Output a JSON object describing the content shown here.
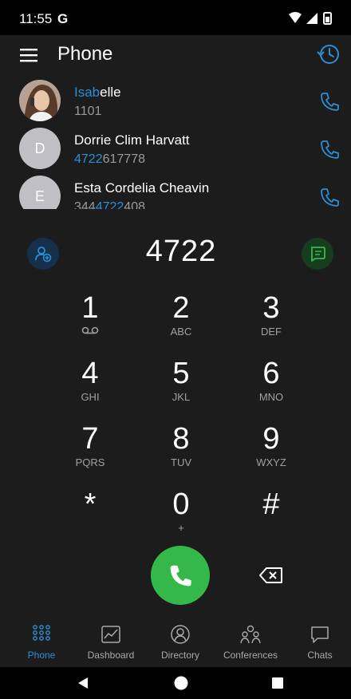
{
  "status": {
    "time": "11:55",
    "g_label": "G"
  },
  "header": {
    "title": "Phone",
    "menu_icon": "hamburger-menu-icon",
    "history_icon": "history-icon"
  },
  "contacts": [
    {
      "name_match": "Isab",
      "name_rest": "elle",
      "number_pre": "",
      "number_match": "",
      "number_post": "1101",
      "avatar_letter": "",
      "avatar_type": "photo"
    },
    {
      "name_match": "",
      "name_rest": "Dorrie Clim Harvatt",
      "number_pre": "",
      "number_match": "4722",
      "number_post": "617778",
      "avatar_letter": "D",
      "avatar_type": "letter"
    },
    {
      "name_match": "",
      "name_rest": "Esta Cordelia Cheavin",
      "number_pre": "344",
      "number_match": "4722",
      "number_post": "408",
      "avatar_letter": "E",
      "avatar_type": "letter"
    }
  ],
  "dialer": {
    "input": "4722",
    "keys": [
      {
        "digit": "1",
        "sub": ""
      },
      {
        "digit": "2",
        "sub": "ABC"
      },
      {
        "digit": "3",
        "sub": "DEF"
      },
      {
        "digit": "4",
        "sub": "GHI"
      },
      {
        "digit": "5",
        "sub": "JKL"
      },
      {
        "digit": "6",
        "sub": "MNO"
      },
      {
        "digit": "7",
        "sub": "PQRS"
      },
      {
        "digit": "8",
        "sub": "TUV"
      },
      {
        "digit": "9",
        "sub": "WXYZ"
      },
      {
        "digit": "*",
        "sub": ""
      },
      {
        "digit": "0",
        "sub": "+"
      },
      {
        "digit": "#",
        "sub": ""
      }
    ]
  },
  "nav": {
    "items": [
      {
        "label": "Phone",
        "active": true
      },
      {
        "label": "Dashboard",
        "active": false
      },
      {
        "label": "Directory",
        "active": false
      },
      {
        "label": "Conferences",
        "active": false
      },
      {
        "label": "Chats",
        "active": false
      }
    ]
  },
  "colors": {
    "accent": "#2a8fd6",
    "call_green": "#35b84a",
    "background": "#1c1c1c"
  }
}
